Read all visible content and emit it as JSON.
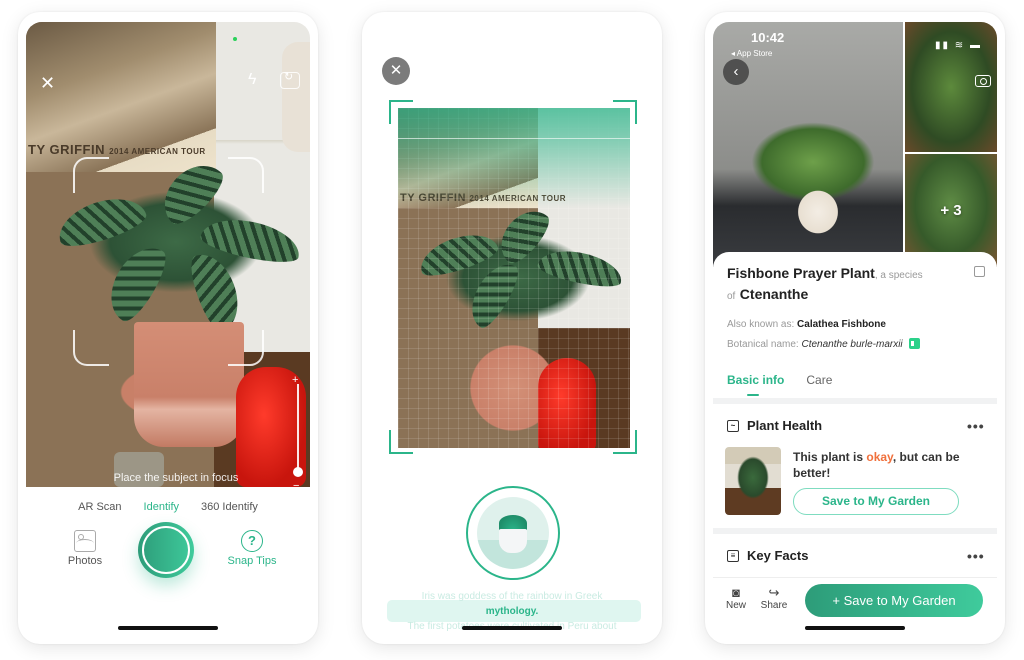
{
  "screen1": {
    "poster_text": "TY GRIFFIN",
    "poster_subtext": "2014 AMERICAN TOUR",
    "icons": {
      "close": "✕",
      "flash": "ϟ",
      "flip": "camera-flip"
    },
    "zoom_plus": "+",
    "zoom_minus": "−",
    "focus_hint": "Place the subject in focus",
    "mode_tabs": [
      {
        "label": "AR Scan",
        "active": false
      },
      {
        "label": "Identify",
        "active": true
      },
      {
        "label": "360 Identify",
        "active": false
      }
    ],
    "photos_label": "Photos",
    "tips_icon": "?",
    "tips_label": "Snap Tips"
  },
  "screen2": {
    "close_icon": "✕",
    "poster_text": "TY GRIFFIN",
    "poster_subtext": "2014 AMERICAN TOUR",
    "facts": {
      "previous": "Iris was goddess of the rainbow in Greek",
      "current": "mythology.",
      "next": "The first potatoes were cultivated in Peru about"
    }
  },
  "screen3": {
    "status": {
      "time": "10:42",
      "back_app": "◂ App Store",
      "icons": "▮▮ ≋ ▬"
    },
    "back_icon": "‹",
    "more_photos_badge": "+ 3",
    "plant_name": "Fishbone Prayer Plant",
    "species_connector": ", a species",
    "genus_prefix": "of",
    "genus": "Ctenanthe",
    "aka_label": "Also known as:",
    "aka_value": "Calathea Fishbone",
    "botanical_label": "Botanical name:",
    "botanical_value": "Ctenanthe burle-marxii",
    "tabs": [
      {
        "label": "Basic info",
        "active": true
      },
      {
        "label": "Care",
        "active": false
      }
    ],
    "health_card": {
      "title": "Plant Health",
      "text_before": "This plant is",
      "status_word": "okay",
      "text_after": ", but can be better!",
      "button_label": "Save to My Garden",
      "status_color": "#f0703c"
    },
    "facts_card": {
      "title": "Key Facts"
    },
    "more_dots": "•••",
    "bottom_bar": {
      "new_label": "New",
      "share_label": "Share",
      "primary_label": "+  Save to My Garden"
    }
  },
  "theme": {
    "accent": "#2bb58a",
    "accent_light": "#dff6f0"
  }
}
